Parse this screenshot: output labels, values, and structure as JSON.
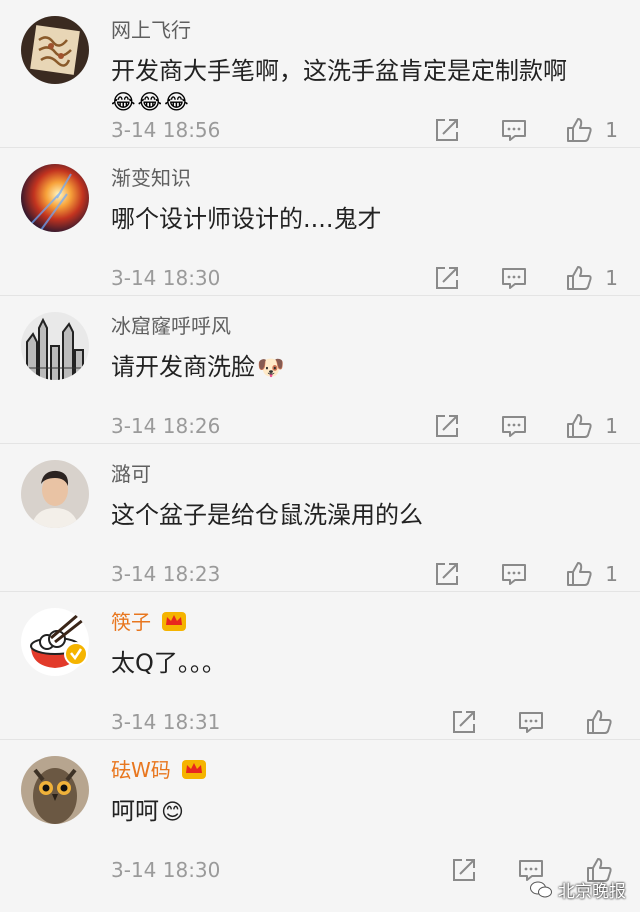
{
  "comments": [
    {
      "username": "网上飞行",
      "text": "开发商大手笔啊，这洗手盆肯定是定制款啊",
      "emojis": [
        "😂",
        "😂",
        "😂"
      ],
      "time": "3-14 18:56",
      "likes": "1",
      "avatar_icon": "patterned-tile-avatar",
      "vip": false
    },
    {
      "username": "渐变知识",
      "text": "哪个设计师设计的....鬼才",
      "time": "3-14 18:30",
      "likes": "1",
      "avatar_icon": "light-burst-avatar",
      "vip": false
    },
    {
      "username": "冰窟窿呼呼风",
      "text": "请开发商洗脸",
      "text_emoji": "🐶",
      "time": "3-14 18:26",
      "likes": "1",
      "avatar_icon": "sketch-city-avatar",
      "vip": false
    },
    {
      "username": "潞可",
      "text": "这个盆子是给仓鼠洗澡用的么",
      "time": "3-14 18:23",
      "likes": "1",
      "avatar_icon": "person-photo-avatar",
      "vip": false
    },
    {
      "username": "筷子",
      "text": "太Q了。。。",
      "time": "3-14 18:31",
      "likes": "",
      "avatar_icon": "rice-bowl-chopsticks-avatar",
      "vip": true
    },
    {
      "username": "砝W码",
      "text": "呵呵",
      "text_emoji": "😊",
      "time": "3-14 18:30",
      "likes": "",
      "avatar_icon": "owl-photo-avatar",
      "vip": true
    }
  ],
  "watermark": "北京晚报",
  "colors": {
    "background": "#f5f5f5",
    "username": "#5f5f5f",
    "vip_username": "#e8761e",
    "text": "#222222",
    "meta": "#9a9a9a",
    "icon": "#8a8a8a"
  }
}
